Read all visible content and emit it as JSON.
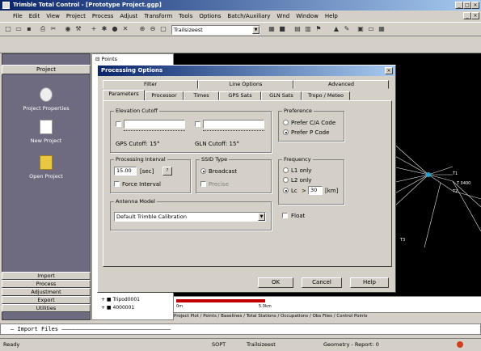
{
  "window": {
    "title": "Trimble Total Control - [Prototype Project.ggp]"
  },
  "menu": [
    "File",
    "Edit",
    "View",
    "Project",
    "Process",
    "Adjust",
    "Transform",
    "Tools",
    "Options",
    "Batch/Auxiliary",
    "Wnd",
    "Window",
    "Help"
  ],
  "toolbar": {
    "combo_value": "Trailsizeest"
  },
  "left_panel": {
    "header": "Project",
    "items": [
      {
        "label": "Project Properties",
        "icon": "properties-icon"
      },
      {
        "label": "New Project",
        "icon": "new-project-icon"
      },
      {
        "label": "Open Project",
        "icon": "open-folder-icon"
      }
    ],
    "bottom_buttons": [
      "Import",
      "Process",
      "Adjustment",
      "Export",
      "Utilities"
    ]
  },
  "tree": {
    "root": "Points",
    "bottom_items": [
      "Tripod0001",
      "4000001"
    ]
  },
  "dialog": {
    "title": "Processing Options",
    "tabs_row1": [
      "Filter",
      "Line Options",
      "Advanced"
    ],
    "tabs_row2": [
      "Parameters",
      "Processor",
      "Times",
      "GPS Sats",
      "GLN Sats",
      "Tropo / Meteo"
    ],
    "elevation_cutoff": {
      "label": "Elevation Cutoff",
      "gps_caption": "GPS Cutoff: 15°",
      "glo_caption": "GLN Cutoff: 15°"
    },
    "processing_interval": {
      "label": "Processing Interval",
      "value": "15.00",
      "unit": "[sec]",
      "force_label": "Force Interval"
    },
    "ssid_type": {
      "label": "SSID Type",
      "options": [
        "Broadcast",
        "Precise"
      ],
      "selected": 0
    },
    "antenna_model": {
      "label": "Antenna Model",
      "value": "Default Trimble Calibration"
    },
    "preference": {
      "label": "Preference",
      "options": [
        "Prefer C/A Code",
        "Prefer P Code"
      ],
      "selected": 1
    },
    "frequency": {
      "label": "Frequency",
      "options": [
        "L1 only",
        "L2 only",
        "Lc"
      ],
      "selected": 2,
      "lc_op": ">",
      "lc_value": "30",
      "lc_unit": "[km]",
      "float_label": "Float"
    },
    "buttons": {
      "ok": "OK",
      "cancel": "Cancel",
      "help": "Help"
    }
  },
  "canvas": {
    "labels": [
      "T1",
      "T 0400",
      "T2",
      "T3"
    ],
    "node_color": "#20a0d0",
    "line_color": "#e8e8e8",
    "scale_left": "0m",
    "scale_right": "5.0km"
  },
  "bottom_tabs": "Project Plot / Points / Baselines / Total Stations / Occupations / Obs Files / Control Points",
  "command_line": "Import Files",
  "status": {
    "left": "Ready",
    "mid1": "SOPT",
    "mid2": "Trailsizeest",
    "mid3": "Geometry - Report: 0"
  }
}
